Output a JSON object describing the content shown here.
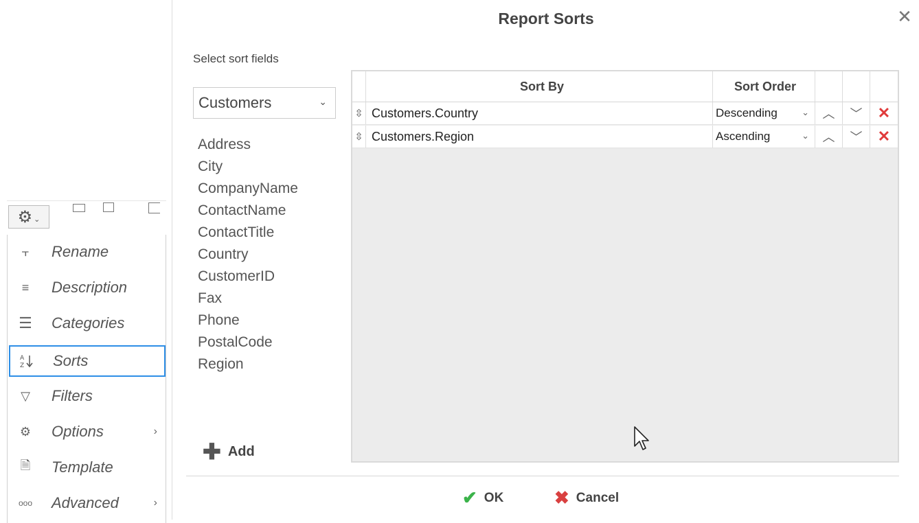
{
  "menu": {
    "items": [
      {
        "label": "Rename",
        "icon": "rename-icon",
        "glyph": "╡"
      },
      {
        "label": "Description",
        "icon": "description-icon",
        "glyph": "≡"
      },
      {
        "label": "Categories",
        "icon": "categories-icon",
        "glyph": "☰"
      },
      {
        "label": "Sorts",
        "icon": "sort-az-icon",
        "glyph": "↧"
      },
      {
        "label": "Filters",
        "icon": "filter-icon",
        "glyph": "▽"
      },
      {
        "label": "Options",
        "icon": "options-gear-icon",
        "glyph": "⚙"
      },
      {
        "label": "Template",
        "icon": "template-icon",
        "glyph": "▤"
      },
      {
        "label": "Advanced",
        "icon": "advanced-dots-icon",
        "glyph": "∘∘∘"
      }
    ],
    "selected": "Sorts",
    "accent_color": "#2d8ee6"
  },
  "dialog": {
    "title": "Report Sorts",
    "select_label": "Select sort fields",
    "table_select_value": "Customers",
    "fields": [
      "Address",
      "City",
      "CompanyName",
      "ContactName",
      "ContactTitle",
      "Country",
      "CustomerID",
      "Fax",
      "Phone",
      "PostalCode",
      "Region"
    ],
    "add_label": "Add",
    "grid": {
      "headers": {
        "sort_by": "Sort By",
        "sort_order": "Sort Order"
      },
      "rows": [
        {
          "sort_by": "Customers.Country",
          "sort_order": "Descending"
        },
        {
          "sort_by": "Customers.Region",
          "sort_order": "Ascending"
        }
      ]
    },
    "ok_label": "OK",
    "cancel_label": "Cancel",
    "colors": {
      "ok": "#3bb34a",
      "delete": "#e03a3a"
    }
  }
}
